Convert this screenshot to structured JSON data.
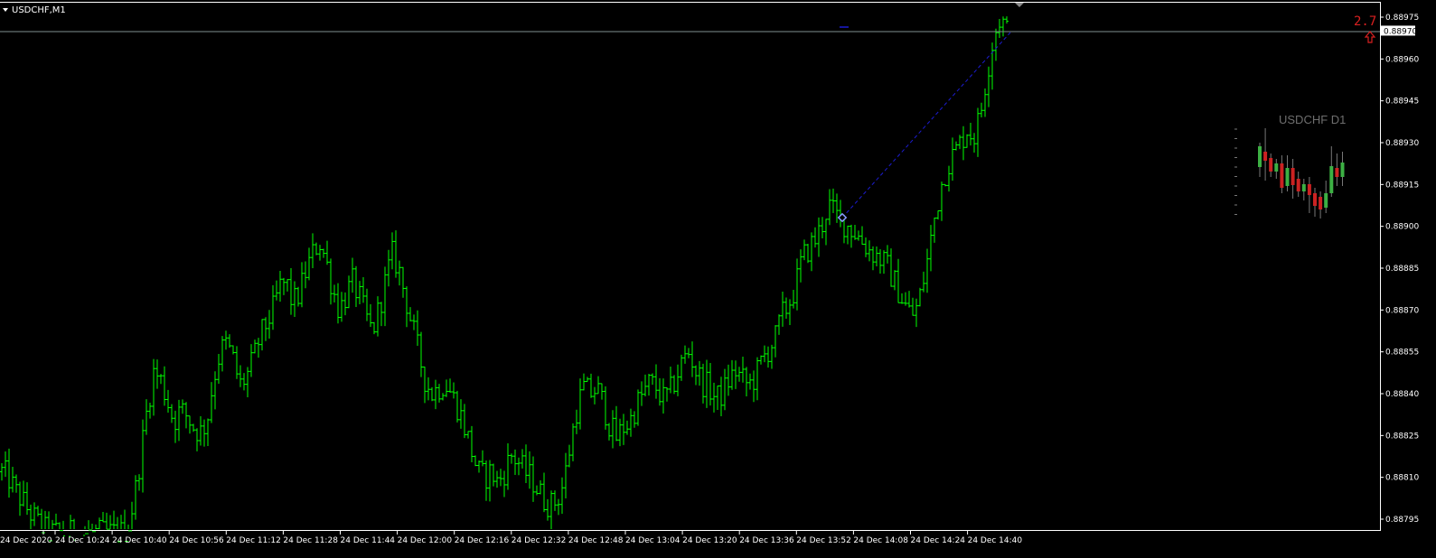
{
  "window": {
    "symbol_title": "USDCHF,M1"
  },
  "mini_chart": {
    "title": "USDCHF D1"
  },
  "indicator": {
    "value_text": "2.7",
    "arrow_icon": "up-arrow-outline-icon",
    "color": "#d82020"
  },
  "price_axis": {
    "current_price": "0.88970",
    "current_price_value": 0.8897,
    "labels": [
      "0.88975",
      "0.88960",
      "0.88945",
      "0.88930",
      "0.88915",
      "0.88900",
      "0.88885",
      "0.88870",
      "0.88855",
      "0.88840",
      "0.88825",
      "0.88810",
      "0.88795"
    ],
    "range": [
      0.8879,
      0.8898
    ]
  },
  "time_axis": {
    "labels": [
      "24 Dec 2020",
      "24 Dec 10:24",
      "24 Dec 10:40",
      "24 Dec 10:56",
      "24 Dec 11:12",
      "24 Dec 11:28",
      "24 Dec 11:44",
      "24 Dec 12:00",
      "24 Dec 12:16",
      "24 Dec 12:32",
      "24 Dec 12:48",
      "24 Dec 13:04",
      "24 Dec 13:20",
      "24 Dec 13:36",
      "24 Dec 13:52",
      "24 Dec 14:08",
      "24 Dec 14:24",
      "24 Dec 14:40"
    ]
  },
  "colors": {
    "background": "#000000",
    "bars": "#00ff00",
    "axis": "#ffffff",
    "bid_line": "#7f8f8f",
    "trend_line": "#1c1cd0",
    "mini_bull": "#3cb043",
    "mini_bear": "#cc2222"
  },
  "chart_data": {
    "type": "bar",
    "title": "USDCHF,M1",
    "ylim": [
      0.8879,
      0.8898
    ],
    "ytick_labels": [
      "0.88975",
      "0.88960",
      "0.88945",
      "0.88930",
      "0.88915",
      "0.88900",
      "0.88885",
      "0.88870",
      "0.88855",
      "0.88840",
      "0.88825",
      "0.88810",
      "0.88795"
    ],
    "xtick_labels": [
      "24 Dec 2020",
      "24 Dec 10:24",
      "24 Dec 10:40",
      "24 Dec 10:56",
      "24 Dec 11:12",
      "24 Dec 11:28",
      "24 Dec 11:44",
      "24 Dec 12:00",
      "24 Dec 12:16",
      "24 Dec 12:32",
      "24 Dec 12:48",
      "24 Dec 13:04",
      "24 Dec 13:20",
      "24 Dec 13:36",
      "24 Dec 13:52",
      "24 Dec 14:08",
      "24 Dec 14:24",
      "24 Dec 14:40"
    ],
    "close_path": [
      0.88812,
      0.8881,
      0.88805,
      0.88802,
      0.88798,
      0.88795,
      0.88792,
      0.8879,
      0.8879,
      0.8879,
      0.8879,
      0.8879,
      0.8879,
      0.8879,
      0.8879,
      0.8879,
      0.8879,
      0.8879,
      0.8879,
      0.88792,
      0.88802,
      0.88818,
      0.88835,
      0.88848,
      0.88845,
      0.88838,
      0.8883,
      0.88834,
      0.88832,
      0.88828,
      0.88826,
      0.8883,
      0.88845,
      0.88855,
      0.88858,
      0.88852,
      0.88843,
      0.88846,
      0.88852,
      0.8886,
      0.88865,
      0.8887,
      0.88878,
      0.8888,
      0.88872,
      0.88876,
      0.88884,
      0.8889,
      0.88895,
      0.88888,
      0.88878,
      0.8887,
      0.88875,
      0.8888,
      0.88875,
      0.88868,
      0.88862,
      0.8887,
      0.8888,
      0.8889,
      0.88885,
      0.88875,
      0.88865,
      0.88855,
      0.88845,
      0.8884,
      0.88842,
      0.88844,
      0.8884,
      0.88835,
      0.88828,
      0.8882,
      0.88812,
      0.8881,
      0.88812,
      0.88808,
      0.88812,
      0.88818,
      0.88816,
      0.88812,
      0.8881,
      0.88806,
      0.88802,
      0.888,
      0.88802,
      0.88808,
      0.88822,
      0.88835,
      0.88842,
      0.8884,
      0.88842,
      0.88836,
      0.88828,
      0.88824,
      0.88828,
      0.8883,
      0.88836,
      0.8884,
      0.88844,
      0.88842,
      0.88838,
      0.8884,
      0.88846,
      0.88852,
      0.88855,
      0.88848,
      0.88844,
      0.88842,
      0.88838,
      0.8884,
      0.88845,
      0.88848,
      0.88845,
      0.88843,
      0.88846,
      0.88852,
      0.88856,
      0.8886,
      0.88868,
      0.88872,
      0.88878,
      0.88888,
      0.88892,
      0.88895,
      0.889,
      0.88908,
      0.88904,
      0.88902,
      0.889,
      0.88898,
      0.88895,
      0.88892,
      0.8889,
      0.88888,
      0.88885,
      0.8888,
      0.88875,
      0.8887,
      0.88868,
      0.88876,
      0.88888,
      0.88902,
      0.88914,
      0.88922,
      0.88926,
      0.8893,
      0.88935,
      0.88932,
      0.8894,
      0.88955,
      0.88968,
      0.88975,
      0.8897
    ]
  }
}
